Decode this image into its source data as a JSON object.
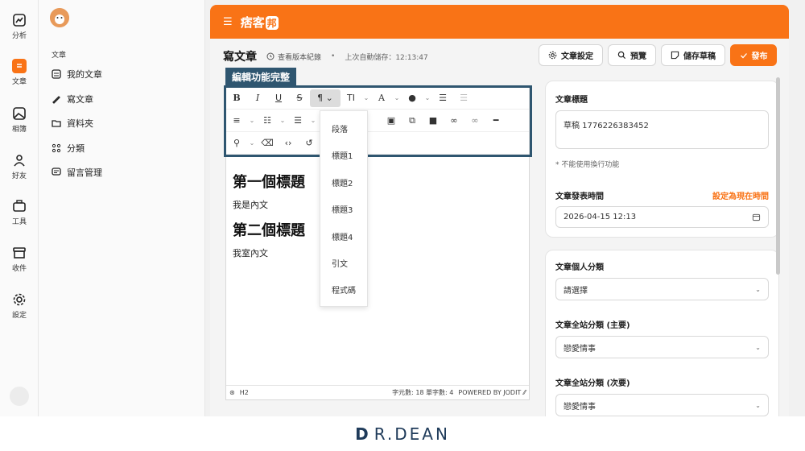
{
  "rail": {
    "items": [
      {
        "label": "分析",
        "icon": "chart-icon"
      },
      {
        "label": "文章",
        "icon": "article-icon",
        "active": true
      },
      {
        "label": "相簿",
        "icon": "image-icon"
      },
      {
        "label": "好友",
        "icon": "person-icon"
      },
      {
        "label": "工具",
        "icon": "briefcase-icon"
      },
      {
        "label": "收件",
        "icon": "inbox-icon"
      },
      {
        "label": "設定",
        "icon": "gear-icon"
      }
    ]
  },
  "nav": {
    "section": "文章",
    "items": [
      {
        "label": "我的文章",
        "icon": "document-icon"
      },
      {
        "label": "寫文章",
        "icon": "pen-icon"
      },
      {
        "label": "資料夾",
        "icon": "folder-icon"
      },
      {
        "label": "分類",
        "icon": "grid-icon"
      },
      {
        "label": "留言管理",
        "icon": "comment-icon"
      }
    ]
  },
  "topbar": {
    "logo": "痞客",
    "logo_badge": "邦",
    "menu_icon": "☰"
  },
  "header": {
    "title": "寫文章",
    "history": "查看版本紀錄",
    "autosave": "上次自動儲存：12:13:47",
    "buttons": {
      "settings": "文章設定",
      "preview": "預覽",
      "draft": "儲存草稿",
      "publish": "發布"
    }
  },
  "annotation": {
    "tag": "編輯功能完整"
  },
  "editor": {
    "dropdown": [
      "段落",
      "標題1",
      "標題2",
      "標題3",
      "標題4",
      "引文",
      "程式碼"
    ],
    "content": {
      "h1_a": "第一個標題",
      "p_a": "我是內文",
      "h1_b": "第二個標題",
      "p_b": "我室內文"
    },
    "status": {
      "tag": "H2",
      "counts": "字元數: 18  單字數: 4",
      "powered": "POWERED BY JODIT"
    }
  },
  "panel": {
    "title_label": "文章標題",
    "title_value": "草稿 1776226383452",
    "title_hint": "* 不能使用換行功能",
    "publish_time_label": "文章發表時間",
    "set_now": "設定為現在時間",
    "publish_time_value": "2026-04-15 12:13",
    "personal_category_label": "文章個人分類",
    "personal_category_value": "請選擇",
    "site_category_main_label": "文章全站分類 (主要)",
    "site_category_main_value": "戀愛情事",
    "site_category_sub_label": "文章全站分類 (次要)",
    "site_category_sub_value": "戀愛情事"
  },
  "footer": {
    "brand": "R.DEAN",
    "brand_mark": "D"
  },
  "colors": {
    "accent": "#f97316",
    "annotation": "#2f5670"
  }
}
